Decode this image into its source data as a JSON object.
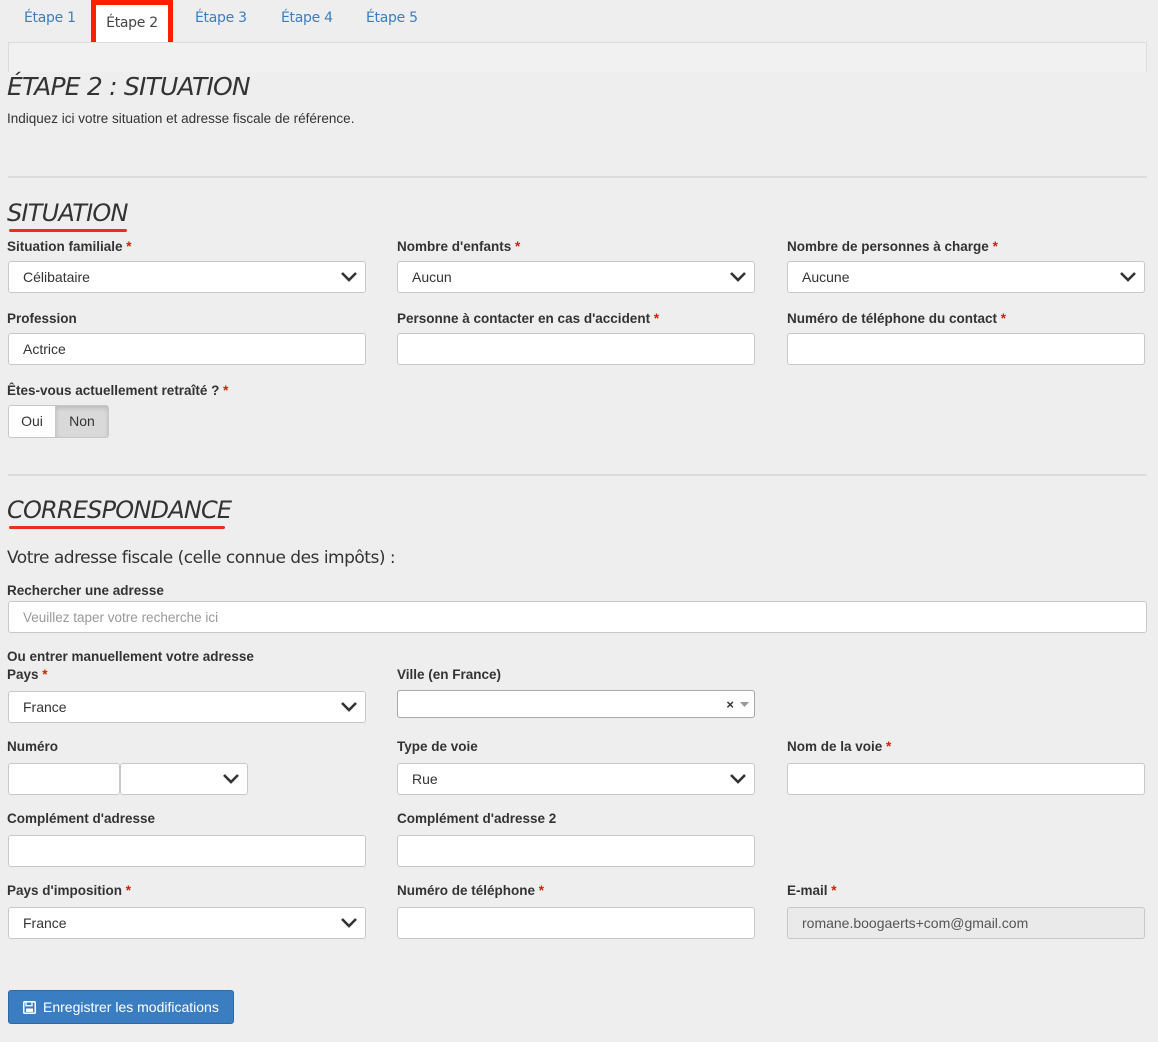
{
  "tabs": [
    "Étape 1",
    "Étape 2",
    "Étape 3",
    "Étape 4",
    "Étape 5"
  ],
  "page_title": "ÉTAPE 2 : SITUATION",
  "page_intro": "Indiquez ici votre situation et adresse fiscale de référence.",
  "situation": {
    "heading": "SITUATION",
    "situation_familiale": {
      "label": "Situation familiale",
      "value": "Célibataire"
    },
    "nombre_enfants": {
      "label": "Nombre d'enfants",
      "value": "Aucun"
    },
    "personnes_charge": {
      "label": "Nombre de personnes à charge",
      "value": "Aucune"
    },
    "profession": {
      "label": "Profession",
      "value": "Actrice"
    },
    "contact_accident": {
      "label": "Personne à contacter en cas d'accident",
      "value": ""
    },
    "contact_phone": {
      "label": "Numéro de téléphone du contact",
      "value": ""
    },
    "retraite": {
      "label": "Êtes-vous actuellement retraîté ?",
      "oui": "Oui",
      "non": "Non",
      "selected": "Non"
    }
  },
  "correspondance": {
    "heading": "CORRESPONDANCE",
    "subheading": "Votre adresse fiscale (celle connue des impôts) :",
    "search": {
      "label": "Rechercher une adresse",
      "placeholder": "Veuillez taper votre recherche ici"
    },
    "manual_label": "Ou entrer manuellement votre adresse",
    "pays": {
      "label": "Pays",
      "value": "France"
    },
    "ville": {
      "label": "Ville (en France)",
      "value": "",
      "clear": "×"
    },
    "numero": {
      "label": "Numéro",
      "value": "",
      "suffix": ""
    },
    "type_voie": {
      "label": "Type de voie",
      "value": "Rue"
    },
    "nom_voie": {
      "label": "Nom de la voie",
      "value": ""
    },
    "complement": {
      "label": "Complément d'adresse",
      "value": ""
    },
    "complement2": {
      "label": "Complément d'adresse 2",
      "value": ""
    },
    "pays_imposition": {
      "label": "Pays d'imposition",
      "value": "France"
    },
    "telephone": {
      "label": "Numéro de téléphone",
      "value": ""
    },
    "email": {
      "label": "E-mail",
      "value": "romane.boogaerts+com@gmail.com"
    }
  },
  "save_button": "Enregistrer les modifications",
  "required_mark": "*",
  "colors": {
    "accent": "#3a7ec1",
    "highlight": "#ff1e00",
    "required": "#cc2200"
  }
}
